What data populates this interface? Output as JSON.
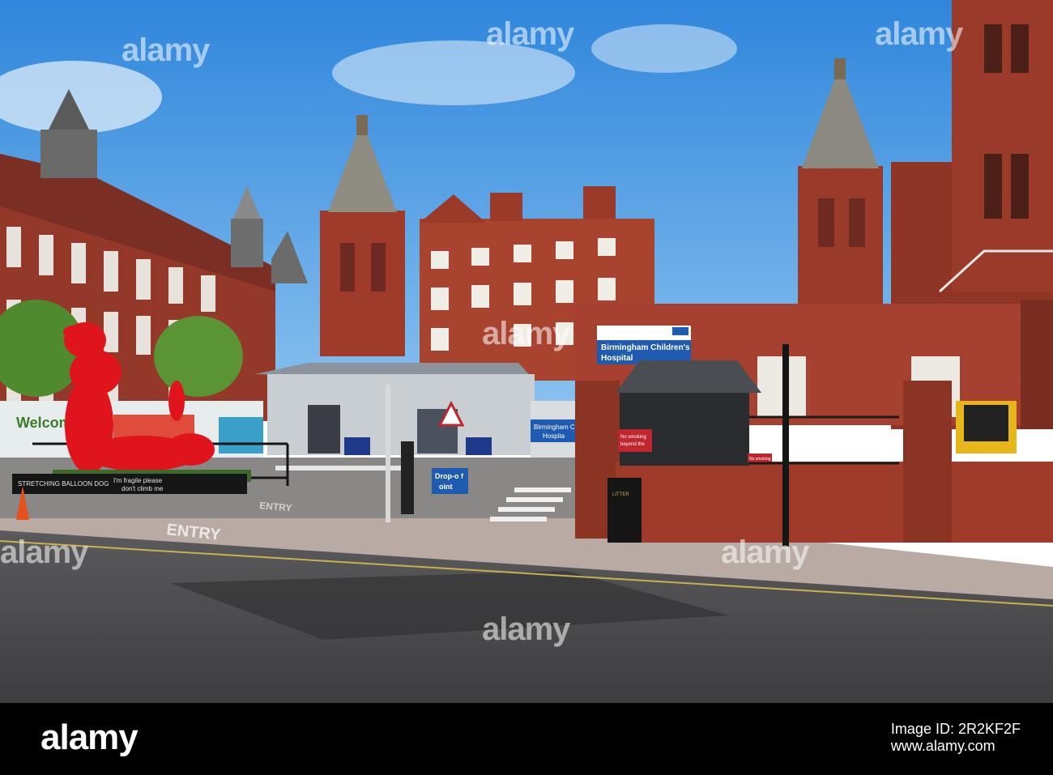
{
  "photo": {
    "hospital_sign": {
      "line1": "Birmingham Children's",
      "line2": "Hospital"
    },
    "inner_sign": {
      "line1": "Birmingham Ch",
      "line2": "Hospita"
    },
    "dropoff_sign": {
      "line1": "Drop-o f",
      "line2": "oint"
    },
    "road_marking": "ENTRY",
    "road_marking_upper": "ENTRY",
    "no_smoking_sign": {
      "line1": "No smoking",
      "line2": "beyond the"
    },
    "no_smoking_small": "No smoking",
    "bin_label": "LITTER",
    "sculpture_plaque": {
      "line1": "I'm fragile please",
      "line2": "don't climb me"
    },
    "sculpture_plaque_name": "STRETCHING BALLOON DOG",
    "mural_text": "Welcome",
    "watermarks": [
      "alamy",
      "alamy",
      "alamy",
      "alamy",
      "alamy",
      "alamy",
      "alamy"
    ]
  },
  "footer": {
    "logo": "alamy",
    "image_id_label": "Image ID:",
    "image_id": "2R2KF2F",
    "url": "www.alamy.com"
  },
  "colors": {
    "sky": "#3a8fe0",
    "brick": "#9a3a2a",
    "balloon_dog": "#e0141c",
    "road": "#4a4a4a",
    "sign_blue": "#1f5bb0"
  }
}
